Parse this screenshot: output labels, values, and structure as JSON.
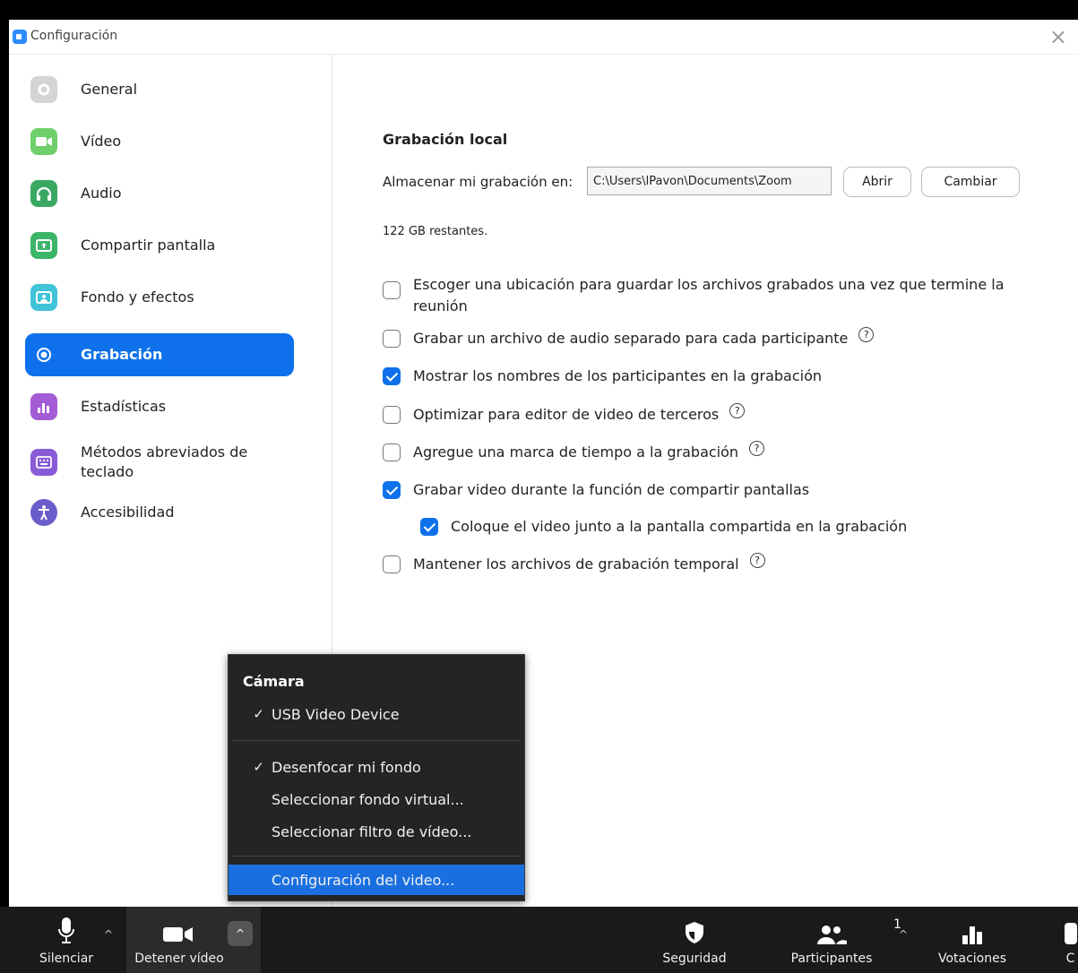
{
  "window": {
    "title": "Configuración",
    "close_glyph": "×"
  },
  "sidebar": {
    "items": [
      {
        "label": "General",
        "icon": "gear-icon",
        "color": "#d4d4d4"
      },
      {
        "label": "Vídeo",
        "icon": "video-camera-icon",
        "color": "#6fcf6a"
      },
      {
        "label": "Audio",
        "icon": "headphones-icon",
        "color": "#39a862"
      },
      {
        "label": "Compartir pantalla",
        "icon": "share-screen-icon",
        "color": "#3cb46a"
      },
      {
        "label": "Fondo y efectos",
        "icon": "background-person-icon",
        "color": "#40c4d8"
      },
      {
        "label": "Grabación",
        "icon": "record-icon",
        "color": "#0e71eb",
        "active": true
      },
      {
        "label": "Estadísticas",
        "icon": "statistics-icon",
        "color": "#a35bd6"
      },
      {
        "label": "Métodos abreviados de teclado",
        "icon": "keyboard-icon",
        "color": "#8a5bd6"
      },
      {
        "label": "Accesibilidad",
        "icon": "accessibility-icon",
        "color": "#6a5cc9"
      }
    ]
  },
  "recording": {
    "section_title": "Grabación local",
    "store_label": "Almacenar mi grabación en:",
    "path_value": "C:\\Users\\lPavon\\Documents\\Zoom",
    "open_button": "Abrir",
    "change_button": "Cambiar",
    "remaining": "122 GB restantes.",
    "options": [
      {
        "label": "Escoger una ubicación para guardar los archivos grabados una vez que termine la reunión",
        "checked": false,
        "help": false
      },
      {
        "label": "Grabar un archivo de audio separado para cada participante",
        "checked": false,
        "help": true
      },
      {
        "label": "Mostrar los nombres de los participantes en la grabación",
        "checked": true,
        "help": false
      },
      {
        "label": "Optimizar para editor de video de terceros",
        "checked": false,
        "help": true
      },
      {
        "label": "Agregue una marca de tiempo a la grabación",
        "checked": false,
        "help": true
      },
      {
        "label": "Grabar video durante la función de compartir pantallas",
        "checked": true,
        "help": false
      },
      {
        "label": "Coloque el video junto a la pantalla compartida en la grabación",
        "checked": true,
        "help": false,
        "indent": true
      },
      {
        "label": "Mantener los archivos de grabación temporal",
        "checked": false,
        "help": true
      }
    ],
    "help_glyph": "?"
  },
  "video_menu": {
    "header": "Cámara",
    "items": [
      {
        "label": "USB Video Device",
        "checked": true
      },
      {
        "label": "Desenfocar mi fondo",
        "checked": true
      },
      {
        "label": "Seleccionar fondo virtual...",
        "checked": false
      },
      {
        "label": "Seleccionar filtro de vídeo...",
        "checked": false
      },
      {
        "label": "Configuración del video...",
        "checked": false,
        "highlighted": true
      }
    ],
    "check_glyph": "✓"
  },
  "toolbar": {
    "mute_label": "Silenciar",
    "stop_video_label": "Detener vídeo",
    "security_label": "Seguridad",
    "participants_label": "Participantes",
    "participants_count": "1",
    "polls_label": "Votaciones",
    "caret_glyph": "^",
    "truncated_label": "C"
  }
}
